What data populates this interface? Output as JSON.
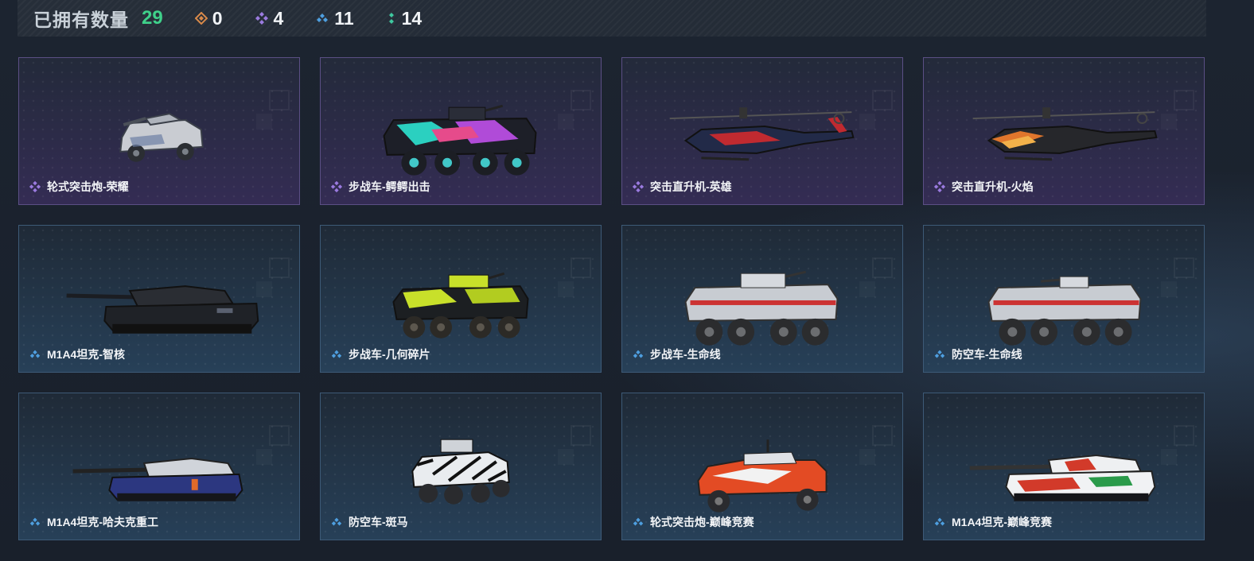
{
  "header": {
    "owned_label": "已拥有数量",
    "owned_count": "29",
    "stats": [
      {
        "icon": "orange-gem-icon",
        "color": "#d98a4a",
        "value": "0"
      },
      {
        "icon": "purple-gem-icon",
        "color": "#9b7be0",
        "value": "4"
      },
      {
        "icon": "blue-gem-icon",
        "color": "#4e9fe0",
        "value": "11"
      },
      {
        "icon": "green-gem-icon",
        "color": "#3fc9a0",
        "value": "14"
      }
    ]
  },
  "cards": [
    {
      "name": "轮式突击炮-荣耀",
      "rarity": "purple",
      "vehicle": "wheeled-assault-gun"
    },
    {
      "name": "步战车-鳄鳄出击",
      "rarity": "purple",
      "vehicle": "ifv"
    },
    {
      "name": "突击直升机-英雄",
      "rarity": "purple",
      "vehicle": "helicopter"
    },
    {
      "name": "突击直升机-火焰",
      "rarity": "purple",
      "vehicle": "helicopter"
    },
    {
      "name": "M1A4坦克-智核",
      "rarity": "blue",
      "vehicle": "tank"
    },
    {
      "name": "步战车-几何碎片",
      "rarity": "blue",
      "vehicle": "ifv"
    },
    {
      "name": "步战车-生命线",
      "rarity": "blue",
      "vehicle": "ifv"
    },
    {
      "name": "防空车-生命线",
      "rarity": "blue",
      "vehicle": "ifv"
    },
    {
      "name": "M1A4坦克-哈夫克重工",
      "rarity": "blue",
      "vehicle": "tank"
    },
    {
      "name": "防空车-斑马",
      "rarity": "blue",
      "vehicle": "wheeled-assault-gun"
    },
    {
      "name": "轮式突击炮-巅峰竞赛",
      "rarity": "blue",
      "vehicle": "wheeled-assault-gun"
    },
    {
      "name": "M1A4坦克-巅峰竞赛",
      "rarity": "blue",
      "vehicle": "tank"
    }
  ]
}
